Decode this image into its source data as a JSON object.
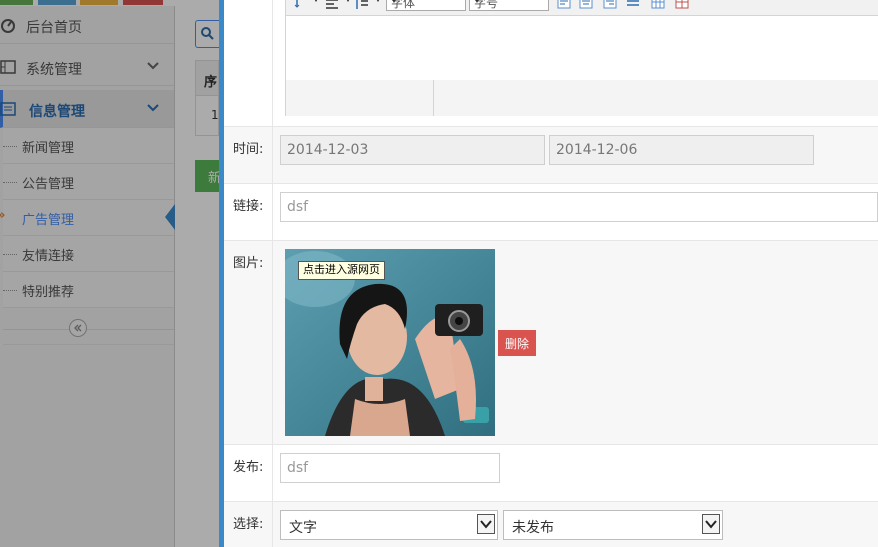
{
  "sidebar": {
    "items": [
      {
        "label": "后台首页"
      },
      {
        "label": "系统管理"
      },
      {
        "label": "信息管理"
      }
    ],
    "sub_items": [
      {
        "label": "新闻管理"
      },
      {
        "label": "公告管理"
      },
      {
        "label": "广告管理"
      },
      {
        "label": "友情连接"
      },
      {
        "label": "特别推荐"
      }
    ]
  },
  "background_table": {
    "header_partial": "序",
    "row_partial": "1",
    "new_button_partial": "新"
  },
  "editor": {
    "font_family_select": "字体",
    "font_size_select": "字号"
  },
  "form": {
    "time": {
      "label": "时间:",
      "start": "2014-12-03",
      "end": "2014-12-06"
    },
    "link": {
      "label": "链接:",
      "value": "dsf"
    },
    "image": {
      "label": "图片:",
      "tooltip": "点击进入源网页",
      "delete_label": "删除"
    },
    "publisher": {
      "label": "发布:",
      "value": "dsf"
    },
    "choice": {
      "label": "选择:",
      "type_value": "文字",
      "status_value": "未发布"
    }
  },
  "colors": {
    "accent": "#3a89c9",
    "active_link": "#4b8df8",
    "delete": "#d9534f",
    "new_button": "#5cb85c"
  }
}
